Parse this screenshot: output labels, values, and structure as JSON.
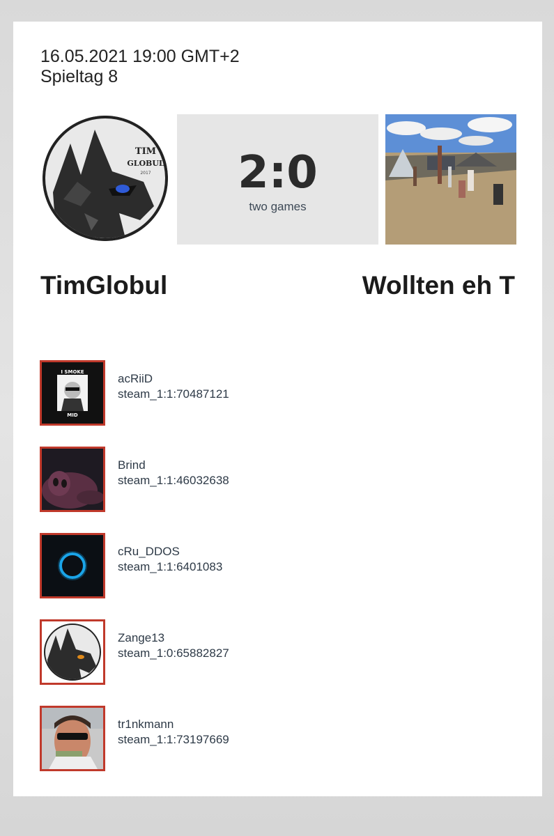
{
  "match": {
    "datetime": "16.05.2021 19:00 GMT+2",
    "matchday": "Spieltag 8",
    "score": "2:0",
    "score_note": "two games"
  },
  "teams": {
    "home": {
      "name": "TimGlobul",
      "logo_text_1": "TIM",
      "logo_text_2": "GLOBUL",
      "logo_year": "2017"
    },
    "away": {
      "name": "Wollten eh T"
    }
  },
  "players": [
    {
      "name": "acRiiD",
      "steam": "steam_1:1:70487121",
      "avatar": "i-smoke-mid-avatar",
      "avatar_text_top": "I SMOKE",
      "avatar_text_bottom": "MID"
    },
    {
      "name": "Brind",
      "steam": "steam_1:1:46032638",
      "avatar": "pink-creature-avatar"
    },
    {
      "name": "cRu_DDOS",
      "steam": "steam_1:1:6401083",
      "avatar": "blue-ring-avatar"
    },
    {
      "name": "Zange13",
      "steam": "steam_1:0:65882827",
      "avatar": "wolf-logo-avatar"
    },
    {
      "name": "tr1nkmann",
      "steam": "steam_1:1:73197669",
      "avatar": "sunglasses-man-avatar"
    }
  ],
  "colors": {
    "avatar_border": "#c0392b",
    "score_bg": "#e6e6e6",
    "text_muted": "#2e3a47"
  }
}
